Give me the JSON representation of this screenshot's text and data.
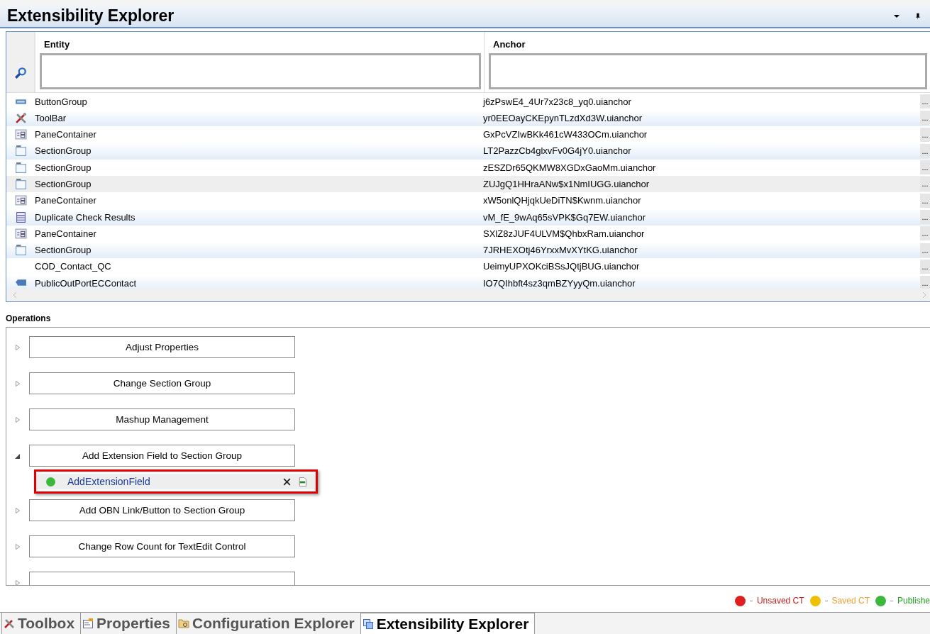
{
  "window": {
    "title": "Extensibility Explorer"
  },
  "grid": {
    "columns": [
      {
        "label": "Entity"
      },
      {
        "label": "Anchor"
      }
    ],
    "rows": [
      {
        "kind": "buttongroup",
        "entity": "ButtonGroup",
        "anchor": "j6zPswE4_4Ur7x23c8_yq0.uianchor",
        "more": "...",
        "selected": false
      },
      {
        "kind": "toolbar",
        "entity": "ToolBar",
        "anchor": "yr0EEOayCKEpynTLzdXd3W.uianchor",
        "more": "...",
        "selected": false
      },
      {
        "kind": "pane",
        "entity": "PaneContainer",
        "anchor": "GxPcVZIwBKk461cW433OCm.uianchor",
        "more": "...",
        "selected": false
      },
      {
        "kind": "section",
        "entity": "SectionGroup",
        "anchor": "LT2PazzCb4glxvFv0G4jY0.uianchor",
        "more": "...",
        "selected": false
      },
      {
        "kind": "section",
        "entity": "SectionGroup",
        "anchor": "zESZDr65QKMW8XGDxGaoMm.uianchor",
        "more": "...",
        "selected": false
      },
      {
        "kind": "section",
        "entity": "SectionGroup",
        "anchor": "ZUJgQ1HHraANw$x1NmIUGG.uianchor",
        "more": "...",
        "selected": true
      },
      {
        "kind": "pane",
        "entity": "PaneContainer",
        "anchor": "xW5onlQHjqkUeDiTN$Kwnm.uianchor",
        "more": "...",
        "selected": false
      },
      {
        "kind": "list",
        "entity": "Duplicate Check Results",
        "anchor": "vM_fE_9wAq65sVPK$Gq7EW.uianchor",
        "more": "...",
        "selected": false
      },
      {
        "kind": "pane",
        "entity": "PaneContainer",
        "anchor": "SXlZ8zJUF4ULVM$QhbxRam.uianchor",
        "more": "...",
        "selected": false
      },
      {
        "kind": "section",
        "entity": "SectionGroup",
        "anchor": "7JRHEXOtj46YrxxMvXYtKG.uianchor",
        "more": "...",
        "selected": false
      },
      {
        "kind": "none",
        "entity": "COD_Contact_QC",
        "anchor": "UeimyUPXOKciBSsJQtjBUG.uianchor",
        "more": "...",
        "selected": false
      },
      {
        "kind": "port",
        "entity": "PublicOutPortECContact",
        "anchor": "IO7QIhbft4sz3qmBZYyyQm.uianchor",
        "more": "...",
        "selected": false
      }
    ]
  },
  "operations": {
    "title": "Operations",
    "items": [
      {
        "label": "Adjust Properties",
        "expanded": false
      },
      {
        "label": "Change Section Group",
        "expanded": false
      },
      {
        "label": "Mashup Management",
        "expanded": false
      },
      {
        "label": "Add Extension Field to Section Group",
        "expanded": true,
        "children": [
          {
            "name": "AddExtensionField",
            "color": "#3cb83c",
            "highlighted": true
          }
        ]
      },
      {
        "label": "Add OBN Link/Button to Section Group",
        "expanded": false
      },
      {
        "label": "Change Row Count for TextEdit Control",
        "expanded": false
      },
      {
        "expanded": false
      }
    ]
  },
  "legend": [
    {
      "label": "Unsaved CT",
      "color": "#e02020"
    },
    {
      "label": "Saved CT",
      "color": "#f0c000"
    },
    {
      "label": "Publishe",
      "color": "#3cb83c"
    }
  ],
  "bottom_tabs": [
    {
      "label": "Toolbox",
      "kind": "tools",
      "selected": false
    },
    {
      "label": "Properties",
      "kind": "props",
      "selected": false
    },
    {
      "label": "Configuration Explorer",
      "kind": "folder",
      "selected": false
    },
    {
      "label": "Extensibility Explorer",
      "kind": "ext",
      "selected": true
    }
  ]
}
